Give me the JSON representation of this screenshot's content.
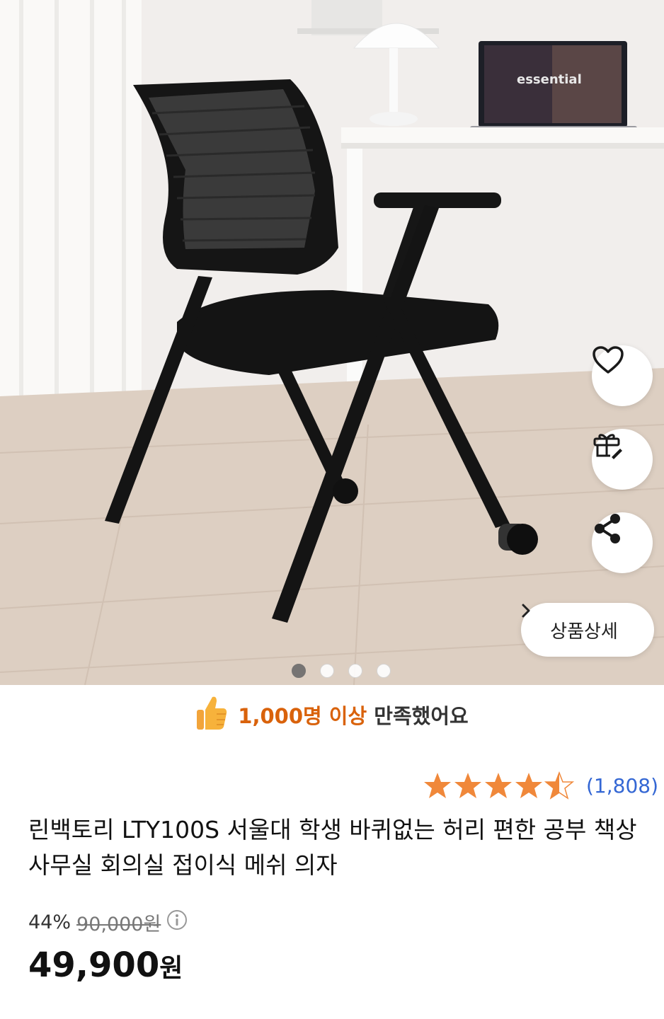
{
  "product_images": {
    "dots_count": 4,
    "active_index": 0,
    "laptop_screen_text": "essential"
  },
  "side_buttons": {
    "wishlist_icon": "heart-icon",
    "gift_icon": "gift-icon",
    "share_icon": "share-icon",
    "detail_label": "상품상세"
  },
  "satisfaction": {
    "highlight": "1,000명 이상",
    "rest": "만족했어요",
    "icon": "thumbs-up-icon"
  },
  "rating": {
    "stars": 4.5,
    "count": "(1,808)",
    "star_color": "#f0883a"
  },
  "product": {
    "title": "린백토리 LTY100S 서울대 학생 바퀴없는 허리 편한 공부 책상 사무실 회의실 접이식 메쉬 의자",
    "discount": "44%",
    "original_price": "90,000원",
    "price": "49,900",
    "price_unit": "원"
  }
}
